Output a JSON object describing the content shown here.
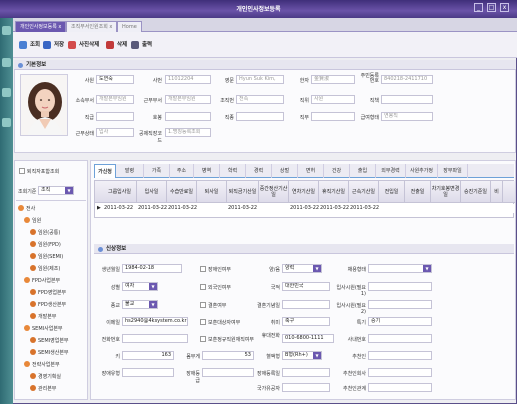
{
  "window": {
    "title": "개인인사정보등록",
    "min": "_",
    "max": "□",
    "close": "x"
  },
  "tabs": [
    {
      "label": "개인인사정보등록",
      "close": "x"
    },
    {
      "label": "조직부서인원조회",
      "close": "x"
    },
    {
      "label": "Home"
    }
  ],
  "toolbar": {
    "search": "조회",
    "save": "저장",
    "delete_photo": "사진삭제",
    "delete": "삭제",
    "print": "출력"
  },
  "basic": {
    "title": "기본정보",
    "labels": {
      "emp_id": "사원",
      "emp_no": "사번",
      "eng_name": "영문",
      "kor_name": "한자",
      "resident_no": "주민등록번호",
      "dept": "소속부서",
      "work_dept": "근무부서",
      "org_type": "조직번",
      "job_class": "직위",
      "position": "직책",
      "grade": "직급",
      "pay_step": "호봉",
      "occupation": "직종",
      "duty": "직무",
      "work_type": "급여형태",
      "status": "근무상태",
      "cost_dept": "공제직장코드"
    },
    "values": {
      "emp_id": "도연숙",
      "emp_no": "11012204",
      "eng_name": "Hyun Suk Kim,",
      "kor_name": "金賢淑",
      "resident_no": "840218-2411710",
      "dept": "개발본부임원",
      "work_dept": "개발본부임원",
      "org_type": "전속",
      "job_class": "사원",
      "position": "",
      "grade": "",
      "pay_step": "",
      "occupation": "",
      "duty": "",
      "work_type": "연봉직",
      "status": "입사",
      "cost_dept": "1.명칭등록조회"
    }
  },
  "left": {
    "retired_check": "퇴직자포함조회",
    "basis_label": "조회기준",
    "basis_value": "조직",
    "tree": [
      {
        "label": "전사",
        "depth": 0
      },
      {
        "label": "임원",
        "depth": 1
      },
      {
        "label": "임원(공통)",
        "depth": 2
      },
      {
        "label": "임원(FPD)",
        "depth": 2
      },
      {
        "label": "임원(SEMI)",
        "depth": 2
      },
      {
        "label": "임원(제조)",
        "depth": 2
      },
      {
        "label": "FPD사업본부",
        "depth": 1
      },
      {
        "label": "FPD영업본부",
        "depth": 2
      },
      {
        "label": "FPD생산본부",
        "depth": 2
      },
      {
        "label": "개발본부",
        "depth": 2
      },
      {
        "label": "SEMI사업본부",
        "depth": 1
      },
      {
        "label": "SEMI영업본부",
        "depth": 2
      },
      {
        "label": "SEMI생산본부",
        "depth": 2
      },
      {
        "label": "전략사업본부",
        "depth": 1
      },
      {
        "label": "경영기획실",
        "depth": 2
      },
      {
        "label": "관리본부",
        "depth": 2
      }
    ]
  },
  "detail_tabs": [
    "가신청",
    "발령",
    "가족",
    "주소",
    "병역",
    "학력",
    "경력",
    "상벌",
    "면허",
    "건강",
    "출입",
    "외부경력",
    "사원추가정",
    "장부파일"
  ],
  "grid": {
    "headers": [
      "그룹입사일",
      "입사일",
      "수습만료일",
      "퇴사일",
      "퇴직금기산일",
      "중간정산기산일",
      "연차기산일",
      "휴직기산일",
      "근속기산일",
      "전입일",
      "전출일",
      "차기호봉변경일",
      "승진기준일",
      "비"
    ],
    "row": [
      "2011-03-22",
      "2011-03-22",
      "2011-03-22",
      "",
      "2011-03-22",
      "",
      "2011-03-22",
      "2011-03-22",
      "2011-03-22",
      "",
      "",
      "",
      "",
      ""
    ]
  },
  "personal": {
    "title": "신상정보",
    "birth_label": "생년월일",
    "birth": "1984-02-18",
    "gender_label": "성별",
    "gender": "여자",
    "religion_label": "종교",
    "religion": "불교",
    "email_label": "이메일",
    "email": "hs2940@4ksystem.co.kr",
    "home_phone_label": "전화번호",
    "home_phone": "",
    "height_label": "키",
    "height": "163",
    "weight_label": "몸무게",
    "weight": "53",
    "disability_kind_label": "장애유형",
    "disability_kind": "",
    "disability_grade_label": "장애등급",
    "disability_grade": "",
    "disabled_check": "장애인여부",
    "foreigner_check": "외국인여부",
    "married_check": "결혼여부",
    "veteran_check": "보훈대상자여부",
    "military_check": "보훈정규직원재직여부",
    "yangeum_label": "양/음",
    "yangeum": "양력",
    "nationality_label": "국적",
    "nationality": "대한민국",
    "marriage_date_label": "결혼기념일",
    "marriage_date": "",
    "hobby_label": "취미",
    "hobby": "축구",
    "mobile_label": "휴대전화",
    "mobile": "010-6800-1111",
    "blood_label": "혈액형",
    "blood": "B형(Rh+)",
    "veteran_no_label": "장애등록일",
    "veteran_no": "",
    "national_merit_label": "국가유공자",
    "national_merit": "",
    "hiring_route_label": "채용형태",
    "hiring_route": "",
    "recruit1_label": "입사시원(필요1)",
    "recruit1": "",
    "recruit2_label": "입사시원(필요2)",
    "recruit2": "",
    "special_label": "특기",
    "special": "승기",
    "recommender_label": "사내번호",
    "recommender": "",
    "recommender2_label": "추천인",
    "recommender2": "",
    "recommender3_label": "추천인회사",
    "recommender3": "",
    "recommender4_label": "추천인관계",
    "recommender4": ""
  }
}
